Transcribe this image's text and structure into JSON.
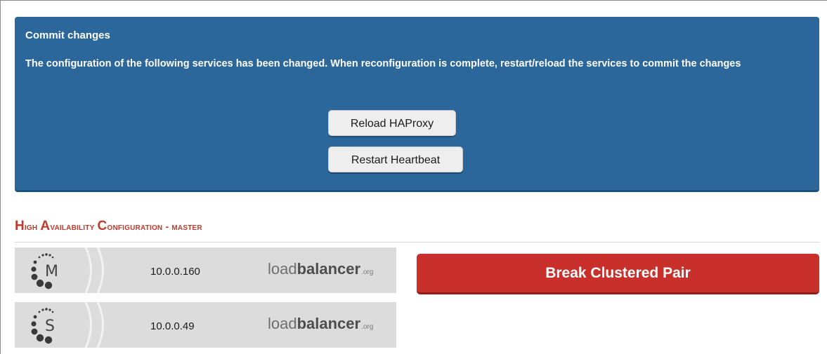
{
  "commit_panel": {
    "title": "Commit changes",
    "message": "The configuration of the following services has been changed. When reconfiguration is complete, restart/reload the services to commit the changes",
    "reload_button": "Reload HAProxy",
    "restart_button": "Restart Heartbeat"
  },
  "ha_section": {
    "title_prefix": "High Availability Configuration - ",
    "title_role": "master",
    "nodes": [
      {
        "letter": "M",
        "ip": "10.0.0.160",
        "brand_light": "load",
        "brand_bold": "balancer",
        "brand_tld": ".org"
      },
      {
        "letter": "S",
        "ip": "10.0.0.49",
        "brand_light": "load",
        "brand_bold": "balancer",
        "brand_tld": ".org"
      }
    ],
    "break_button": "Break Clustered Pair"
  },
  "colors": {
    "panel_blue": "#2b679b",
    "heading_red": "#bf3a2b",
    "break_red": "#c9302c",
    "node_gray": "#dcdcdc"
  }
}
